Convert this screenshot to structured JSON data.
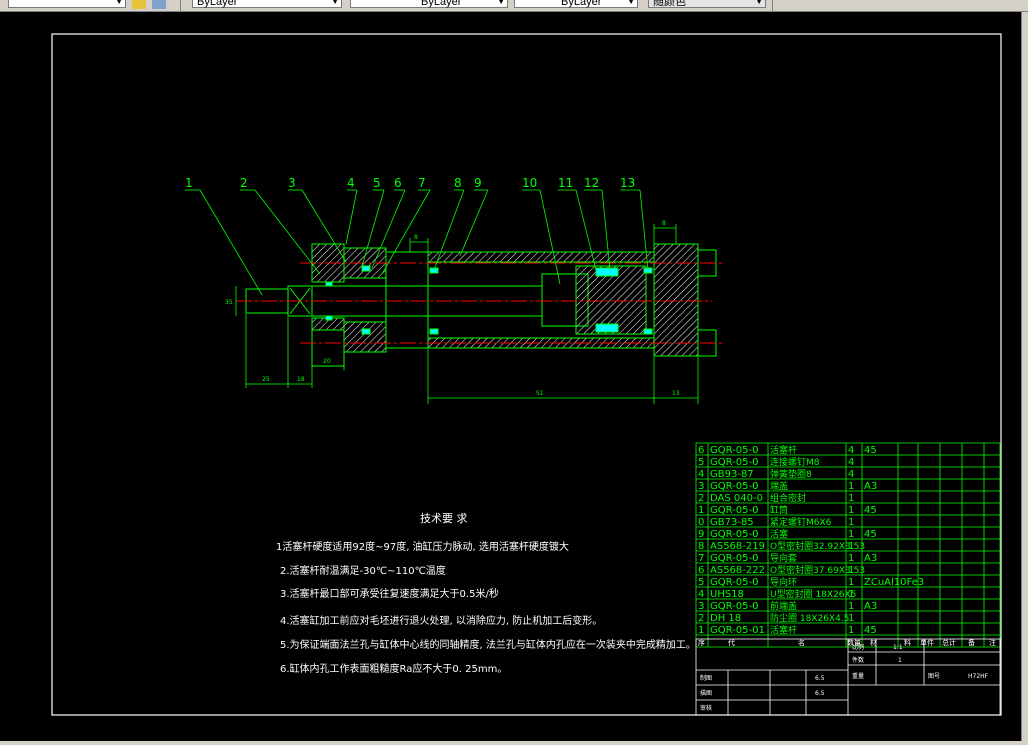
{
  "toolbar": {
    "layer_color": "ByLayer",
    "linetype": "ByLayer",
    "lineweight": "ByLayer",
    "plotstyle": "随颜色"
  },
  "colors": {
    "background": "#000000",
    "frame": "#ffffff",
    "geometry": "#00ff00",
    "text": "#ffffff",
    "centerline": "#ff0000",
    "seal": "#00ffff",
    "hatch": "#ffffff"
  },
  "balloons": [
    "1",
    "2",
    "3",
    "4",
    "5",
    "6",
    "7",
    "8",
    "9",
    "10",
    "11",
    "12",
    "13"
  ],
  "dimensions": {
    "d1": "25",
    "d2": "18",
    "d3": "20",
    "d4": "8",
    "d5": "8",
    "stroke": "S1",
    "d7": "13",
    "dia": "35"
  },
  "notes": {
    "title": "技术要 求",
    "lines": [
      "1活塞杆硬度适用92度~97度, 油缸压力脉动, 选用活塞杆硬度镀大",
      "2.活塞杆耐温满足-30℃~110℃温度",
      "3.活塞杆最口部可承受往复速度满足大于0.5米/秒",
      "4.活塞缸加工前应对毛坯进行退火处理, 以消除应力, 防止机加工后变形。",
      "5.为保证端面法兰孔与缸体中心线的同轴精度, 法兰孔与缸体内孔应在一次装夹中完成精加工。",
      "6.缸体内孔工作表面粗糙度Ra应不大于0.        25mm。"
    ]
  },
  "bom": {
    "rows": [
      {
        "no": "6",
        "code": "GQR-05-0",
        "name": "活塞杆",
        "qty": "4",
        "mat": "45"
      },
      {
        "no": "5",
        "code": "GQR-05-0",
        "name": "连接螺钉M8",
        "qty": "4",
        "mat": ""
      },
      {
        "no": "4",
        "code": "GB93-87",
        "name": "弹簧垫圈8",
        "qty": "4",
        "mat": ""
      },
      {
        "no": "3",
        "code": "GQR-05-0",
        "name": "端盖",
        "qty": "1",
        "mat": "A3"
      },
      {
        "no": "2",
        "code": "DAS 040-0",
        "name": "组合密封",
        "qty": "1",
        "mat": ""
      },
      {
        "no": "1",
        "code": "GQR-05-0",
        "name": "缸筒",
        "qty": "1",
        "mat": "45"
      },
      {
        "no": "0",
        "code": "GB73-85",
        "name": "紧定螺钉M6X6",
        "qty": "1",
        "mat": ""
      },
      {
        "no": "9",
        "code": "GQR-05-0",
        "name": "活塞",
        "qty": "1",
        "mat": "45"
      },
      {
        "no": "8",
        "code": "AS568-219",
        "name": "O型密封圈32.92X3.53",
        "qty": "1",
        "mat": ""
      },
      {
        "no": "7",
        "code": "GQR-05-0",
        "name": "导向套",
        "qty": "1",
        "mat": "A3"
      },
      {
        "no": "6",
        "code": "AS568-222",
        "name": "O型密封圈37.69X3.53",
        "qty": "1",
        "mat": ""
      },
      {
        "no": "5",
        "code": "GQR-05-0",
        "name": "导向环",
        "qty": "1",
        "mat": "ZCuAl10Fe3"
      },
      {
        "no": "4",
        "code": "UHS18",
        "name": "U型密封圈 18X26X5",
        "qty": "1",
        "mat": ""
      },
      {
        "no": "3",
        "code": "GQR-05-0",
        "name": "前端盖",
        "qty": "1",
        "mat": "A3"
      },
      {
        "no": "2",
        "code": "DH 18",
        "name": "防尘圈 18X26X4.5",
        "qty": "1",
        "mat": ""
      },
      {
        "no": "1",
        "code": "GQR-05-01",
        "name": "活塞杆",
        "qty": "1",
        "mat": "45"
      }
    ],
    "header": {
      "no": "序",
      "code": "代",
      "name": "名",
      "qty": "数量",
      "mat": "材",
      "c6": "料",
      "c7": "单件",
      "c8": "总计",
      "c9": "备",
      "c10": "注"
    }
  },
  "titleblock": {
    "scale_label": "比例",
    "scale_value": "1:1",
    "count_label": "件数",
    "count_value": "1",
    "weight_label": "重量",
    "sheet_label": "图号",
    "sheet_value": "H72HF",
    "drawn_label": "制图",
    "drawn_value": "6.5",
    "check_label": "描图",
    "check_value": "6.5",
    "review_label": "审核"
  }
}
